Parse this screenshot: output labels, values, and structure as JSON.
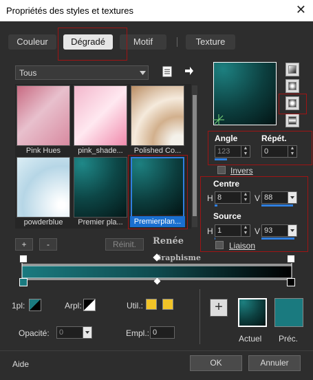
{
  "window": {
    "title": "Propriétés des styles et textures",
    "close": "✕"
  },
  "tabs": [
    "Couleur",
    "Dégradé",
    "Motif",
    "Texture"
  ],
  "category": {
    "selected": "Tous"
  },
  "gradients": [
    {
      "name": "Pink Hues",
      "bg": "linear-gradient(135deg,#c86b82 0%,#e8c0cd 45%,#d88aa0 100%)"
    },
    {
      "name": "pink_shade...",
      "bg": "linear-gradient(135deg,#f3b7cc 0%,#ffe8f0 50%,#f08aac 100%)"
    },
    {
      "name": "Polished Co...",
      "bg": "radial-gradient(circle at 90% 95%,#f4f1ea 10%,#d2b08d 35%,#f5eadc 60%,#b98c62 100%)"
    },
    {
      "name": "powderblue",
      "bg": "radial-gradient(circle at 85% 80%,#ffffff 5%,#b6d6e6 60%,#dceef5 100%)"
    },
    {
      "name": "Premier pla...",
      "bg": "radial-gradient(circle at 15% 10%,#1f8888 0%,#0d4747 50%,#041818 100%)"
    },
    {
      "name": "Premierplan...",
      "bg": "radial-gradient(circle at 15% 10%,#1d8080 0%,#0c3e3e 55%,#031414 100%)"
    }
  ],
  "buttons": {
    "plus": "+",
    "minus": "-",
    "reinit": "Réinit.",
    "ok": "OK",
    "cancel": "Annuler",
    "help": "Aide"
  },
  "angle": {
    "label": "Angle",
    "value": "123",
    "fill": 0.34
  },
  "repeat": {
    "label": "Répét.",
    "value": "0",
    "fill": 0.0
  },
  "invert": {
    "label": "Invers"
  },
  "center": {
    "label": "Centre",
    "h_label": "H",
    "h_value": "8",
    "h_fill": 0.08,
    "v_label": "V",
    "v_value": "88",
    "v_fill": 0.88
  },
  "source": {
    "label": "Source",
    "h_label": "H",
    "h_value": "1",
    "h_fill": 0.01,
    "v_label": "V",
    "v_value": "93",
    "v_fill": 0.93
  },
  "link": {
    "label": "Liaison"
  },
  "watermark": {
    "line1": "Renée",
    "line2": "Graphisme"
  },
  "bottom": {
    "fg_label": "1pl:",
    "bg_label": "Arpl:",
    "util_label": "Util.:",
    "opacity_label": "Opacité:",
    "opacity_value": "0",
    "empl_label": "Empl.:",
    "empl_value": "0"
  },
  "preview": {
    "current_label": "Actuel",
    "previous_label": "Préc."
  },
  "colors": {
    "teal": "#1a7a7f",
    "accent": "#2f7fe0",
    "red": "#a01414",
    "yellow": "#f2c427"
  }
}
